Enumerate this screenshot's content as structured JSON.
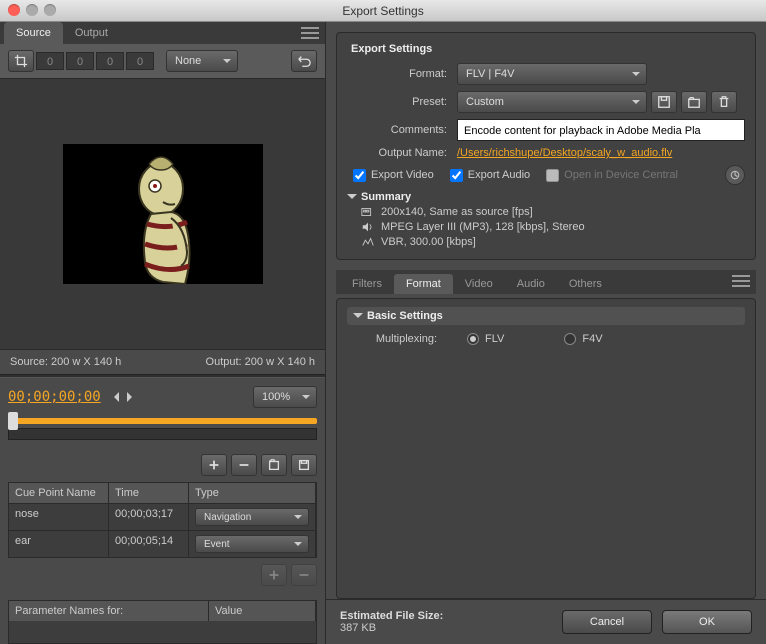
{
  "window": {
    "title": "Export Settings"
  },
  "left": {
    "tabs": [
      "Source",
      "Output"
    ],
    "active_tab": 0,
    "crop": {
      "l": "0",
      "t": "0",
      "r": "0",
      "b": "0",
      "constrain": "None"
    },
    "dims": {
      "source": "Source: 200 w X 140 h",
      "output": "Output: 200 w X 140 h"
    },
    "timecode": "00;00;00;00",
    "zoom": "100%",
    "cue_headers": {
      "name": "Cue Point Name",
      "time": "Time",
      "type": "Type"
    },
    "cues": [
      {
        "name": "nose",
        "time": "00;00;03;17",
        "type": "Navigation"
      },
      {
        "name": "ear",
        "time": "00;00;05;14",
        "type": "Event"
      }
    ],
    "param_headers": {
      "name": "Parameter Names for:",
      "value": "Value"
    }
  },
  "right": {
    "panel_title": "Export Settings",
    "labels": {
      "format": "Format:",
      "preset": "Preset:",
      "comments": "Comments:",
      "output_name": "Output Name:"
    },
    "format": "FLV | F4V",
    "preset": "Custom",
    "comments": "Encode content for playback in Adobe Media Pla",
    "output_name": "/Users/richshupe/Desktop/scaly_w_audio.flv",
    "export_video": {
      "label": "Export Video",
      "checked": true
    },
    "export_audio": {
      "label": "Export Audio",
      "checked": true
    },
    "open_device": {
      "label": "Open in Device Central",
      "checked": false
    },
    "summary_label": "Summary",
    "summary": [
      "200x140, Same as source [fps]",
      "MPEG Layer III (MP3), 128 [kbps], Stereo",
      "VBR, 300.00 [kbps]"
    ],
    "subtabs": [
      "Filters",
      "Format",
      "Video",
      "Audio",
      "Others"
    ],
    "active_subtab": 1,
    "basic": {
      "title": "Basic Settings",
      "mux_label": "Multiplexing:",
      "flv": "FLV",
      "f4v": "F4V",
      "selected": "flv"
    }
  },
  "footer": {
    "est_label": "Estimated File Size:",
    "est_value": "387 KB",
    "cancel": "Cancel",
    "ok": "OK"
  }
}
